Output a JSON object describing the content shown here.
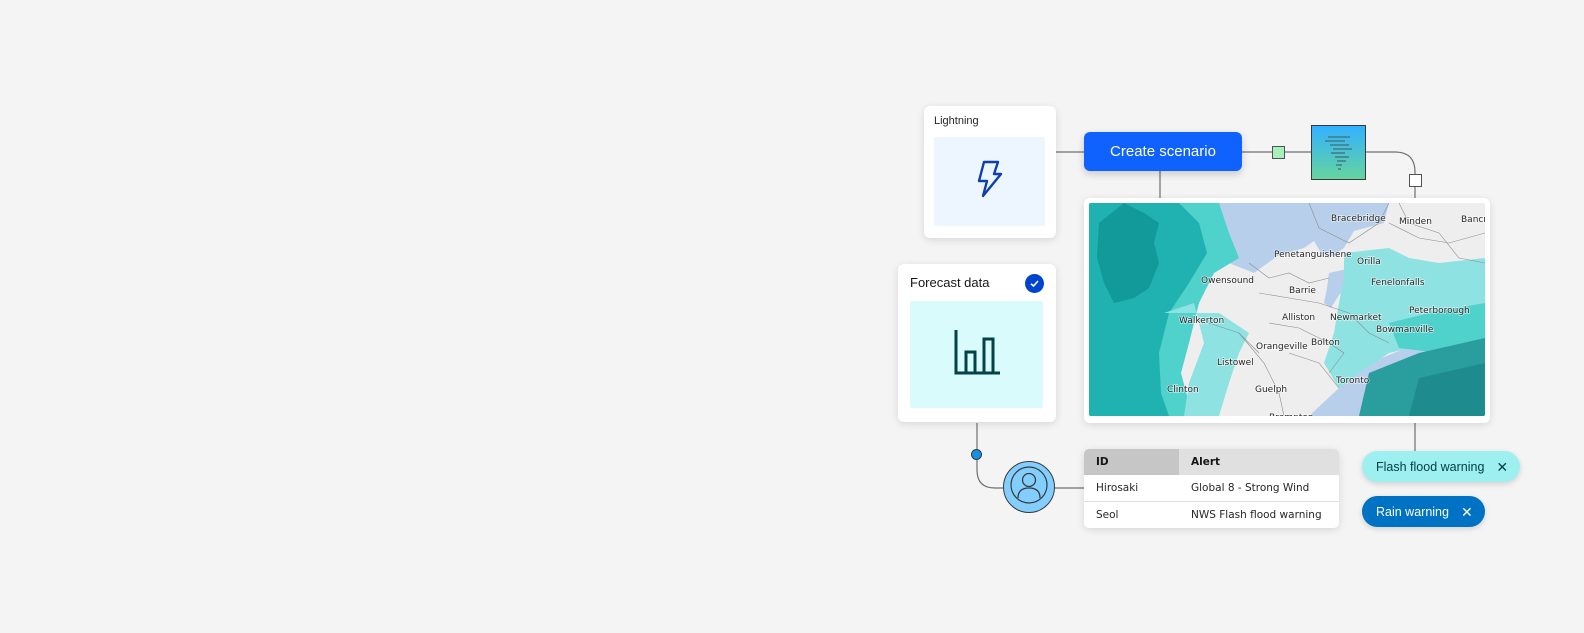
{
  "colors": {
    "background": "#f4f4f4",
    "primary_button": "#0f62fe",
    "lightning_panel": "#edf5ff",
    "forecast_panel": "#d9fbfb",
    "check_badge": "#0043ce",
    "flood_tag": "#9ef0f0",
    "rain_tag": "#0072c3",
    "avatar": "#82cfff",
    "connector_dot": "#1192e8",
    "connector_square_green": "#a7f0ba"
  },
  "lightning_card": {
    "title": "Lightning",
    "icon": "lightning-icon"
  },
  "forecast_card": {
    "title": "Forecast data",
    "icon": "bar-chart-icon",
    "status_icon": "checkmark-icon",
    "checked": true
  },
  "create_button": {
    "label": "Create scenario"
  },
  "tornado_node": {
    "icon": "tornado-icon"
  },
  "map": {
    "labels": [
      {
        "name": "Bracebridge"
      },
      {
        "name": "Minden"
      },
      {
        "name": "Bancroft"
      },
      {
        "name": "Penetanguishene"
      },
      {
        "name": "Orilla"
      },
      {
        "name": "Owensound"
      },
      {
        "name": "Barrie"
      },
      {
        "name": "Fenelonfalls"
      },
      {
        "name": "Peterborough"
      },
      {
        "name": "Walkerton"
      },
      {
        "name": "Alliston"
      },
      {
        "name": "Newmarket"
      },
      {
        "name": "Bowmanville"
      },
      {
        "name": "Orangeville"
      },
      {
        "name": "Bolton"
      },
      {
        "name": "Listowel"
      },
      {
        "name": "Toronto"
      },
      {
        "name": "Clinton"
      },
      {
        "name": "Guelph"
      },
      {
        "name": "Brampton"
      }
    ]
  },
  "alerts_table": {
    "columns": [
      "ID",
      "Alert"
    ],
    "rows": [
      {
        "id": "Hirosaki",
        "alert": "Global 8 - Strong Wind"
      },
      {
        "id": "Seol",
        "alert": "NWS Flash flood warning"
      }
    ]
  },
  "tags": [
    {
      "label": "Flash flood warning",
      "close_icon": "close-icon"
    },
    {
      "label": "Rain warning",
      "close_icon": "close-icon"
    }
  ],
  "avatar": {
    "icon": "user-icon"
  }
}
